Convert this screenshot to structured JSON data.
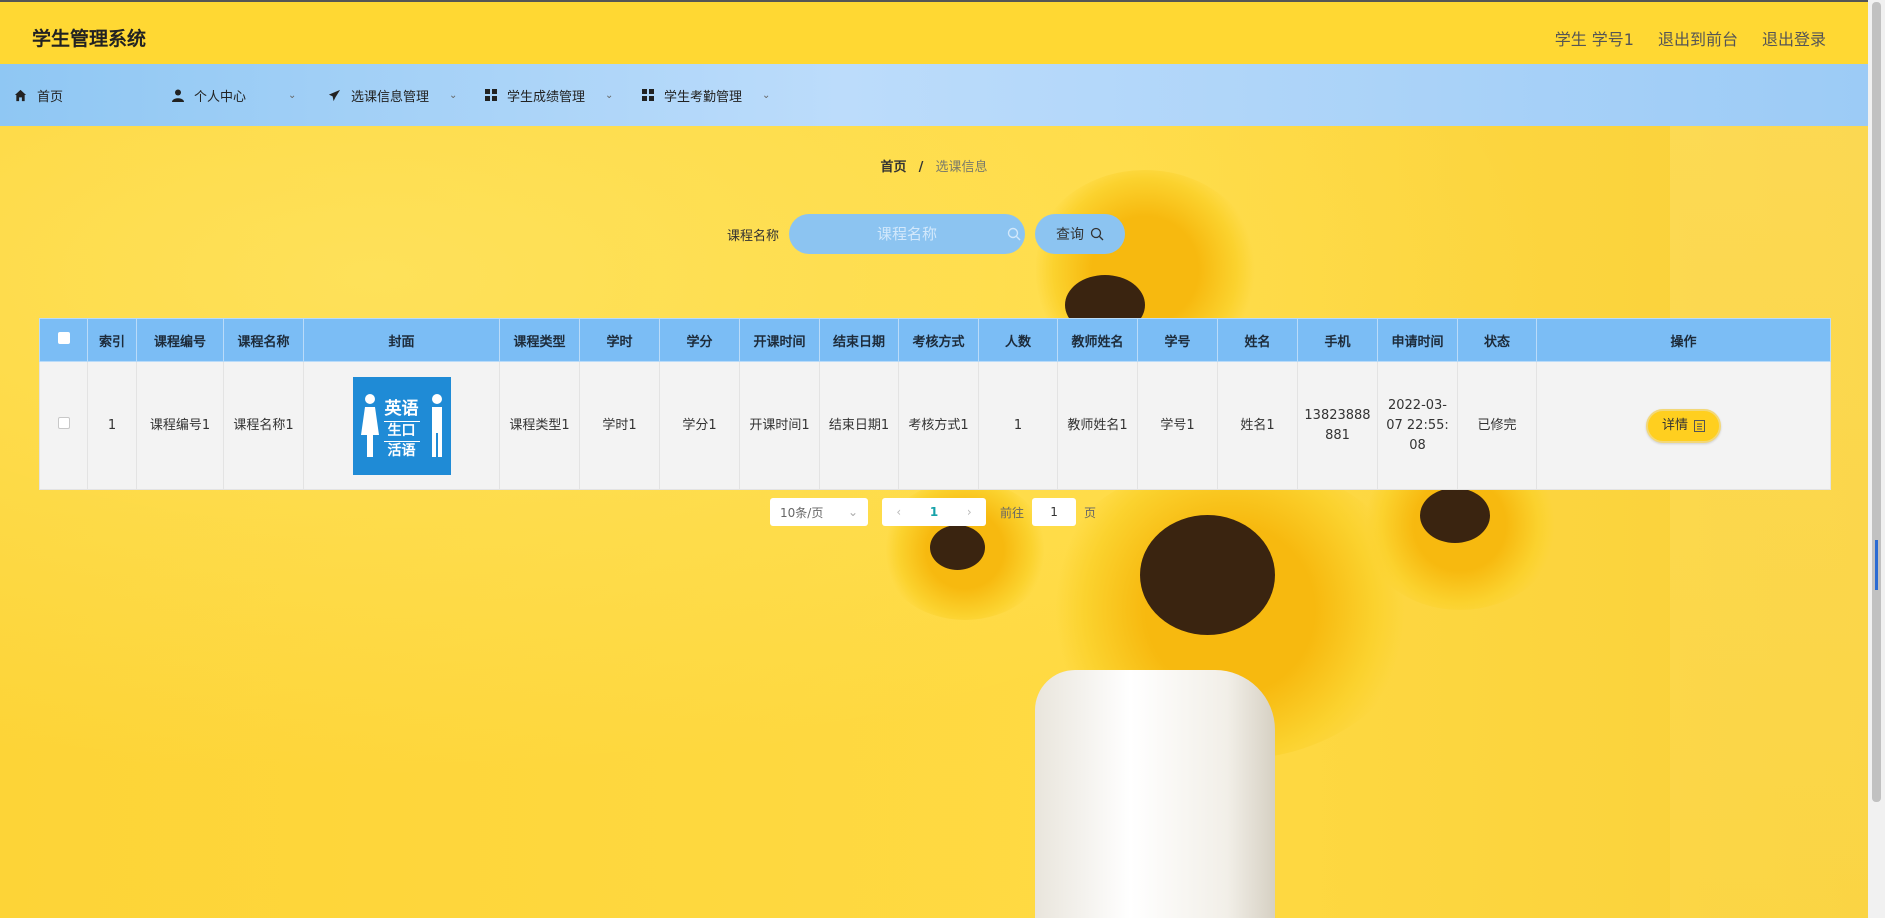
{
  "header": {
    "title": "学生管理系统",
    "links": [
      "学生 学号1",
      "退出到前台",
      "退出登录"
    ]
  },
  "nav": {
    "items": [
      {
        "label": "首页",
        "icon": "home-icon"
      },
      {
        "label": "个人中心",
        "icon": "user-icon"
      },
      {
        "label": "选课信息管理",
        "icon": "paper-plane-icon"
      },
      {
        "label": "学生成绩管理",
        "icon": "grid-icon"
      },
      {
        "label": "学生考勤管理",
        "icon": "grid-icon"
      }
    ]
  },
  "breadcrumb": {
    "home": "首页",
    "separator": "/",
    "current": "选课信息"
  },
  "search": {
    "label": "课程名称",
    "placeholder": "课程名称",
    "button_label": "查询"
  },
  "table": {
    "columns": [
      "索引",
      "课程编号",
      "课程名称",
      "封面",
      "课程类型",
      "学时",
      "学分",
      "开课时间",
      "结束日期",
      "考核方式",
      "人数",
      "教师姓名",
      "学号",
      "姓名",
      "手机",
      "申请时间",
      "状态",
      "操作"
    ],
    "rows": [
      {
        "index": "1",
        "course_code": "课程编号1",
        "course_name": "课程名称1",
        "cover_text": [
          "英语",
          "生口",
          "活语"
        ],
        "course_type": "课程类型1",
        "hours": "学时1",
        "credits": "学分1",
        "start_time": "开课时间1",
        "end_date": "结束日期1",
        "exam_method": "考核方式1",
        "count": "1",
        "teacher_name": "教师姓名1",
        "student_no": "学号1",
        "name": "姓名1",
        "phone": "13823888881",
        "apply_time": "2022-03-07 22:55:08",
        "status": "已修完",
        "action_label": "详情"
      }
    ]
  },
  "pagination": {
    "page_size": "10条/页",
    "current_page": "1",
    "goto_prefix": "前往",
    "goto_value": "1",
    "goto_suffix": "页"
  },
  "colors": {
    "header_bg": "#ffd833",
    "nav_bg": "#8fc7f3",
    "table_header_bg": "#7bbdf5",
    "detail_button": "#ffcf1f"
  }
}
